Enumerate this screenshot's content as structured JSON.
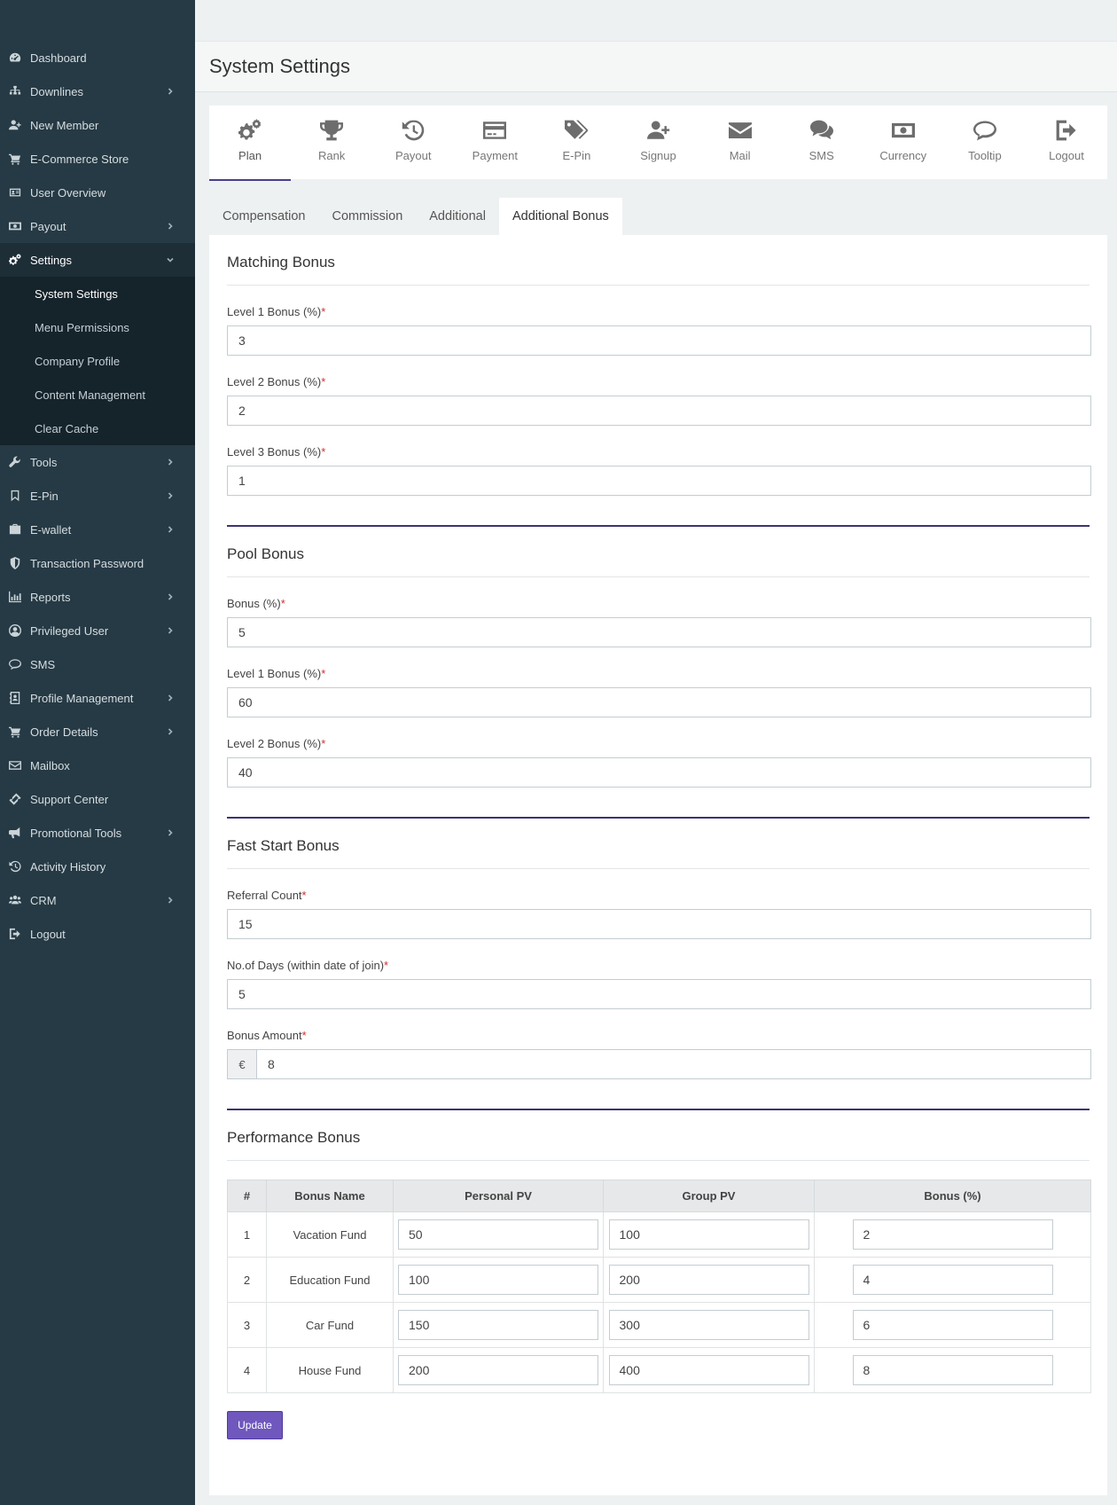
{
  "sidebar": {
    "items": [
      {
        "label": "Dashboard",
        "icon": "dashboard-icon",
        "chevron": false
      },
      {
        "label": "Downlines",
        "icon": "sitemap-icon",
        "chevron": true
      },
      {
        "label": "New Member",
        "icon": "user-plus-icon",
        "chevron": false
      },
      {
        "label": "E-Commerce Store",
        "icon": "cart-icon",
        "chevron": false
      },
      {
        "label": "User Overview",
        "icon": "id-card-icon",
        "chevron": false
      },
      {
        "label": "Payout",
        "icon": "money-icon",
        "chevron": true
      },
      {
        "label": "Settings",
        "icon": "cogs-icon",
        "chevron": true,
        "expanded": true
      }
    ],
    "settings_sub": [
      {
        "label": "System Settings"
      },
      {
        "label": "Menu Permissions"
      },
      {
        "label": "Company Profile"
      },
      {
        "label": "Content Management"
      },
      {
        "label": "Clear Cache"
      }
    ],
    "items_after": [
      {
        "label": "Tools",
        "icon": "wrench-icon",
        "chevron": true
      },
      {
        "label": "E-Pin",
        "icon": "bookmark-icon",
        "chevron": true
      },
      {
        "label": "E-wallet",
        "icon": "briefcase-icon",
        "chevron": true
      },
      {
        "label": "Transaction Password",
        "icon": "shield-icon",
        "chevron": false
      },
      {
        "label": "Reports",
        "icon": "bar-chart-icon",
        "chevron": true
      },
      {
        "label": "Privileged User",
        "icon": "user-circle-icon",
        "chevron": true
      },
      {
        "label": "SMS",
        "icon": "comment-icon",
        "chevron": false
      },
      {
        "label": "Profile Management",
        "icon": "address-book-icon",
        "chevron": true
      },
      {
        "label": "Order Details",
        "icon": "cart-icon",
        "chevron": true
      },
      {
        "label": "Mailbox",
        "icon": "envelope-icon",
        "chevron": false
      },
      {
        "label": "Support Center",
        "icon": "ticket-icon",
        "chevron": false
      },
      {
        "label": "Promotional Tools",
        "icon": "bullhorn-icon",
        "chevron": true
      },
      {
        "label": "Activity History",
        "icon": "history-icon",
        "chevron": false
      },
      {
        "label": "CRM",
        "icon": "users-icon",
        "chevron": true
      },
      {
        "label": "Logout",
        "icon": "sign-out-icon",
        "chevron": false
      }
    ]
  },
  "header": {
    "title": "System Settings"
  },
  "icon_tabs": [
    {
      "label": "Plan",
      "icon": "cogs-icon",
      "active": true
    },
    {
      "label": "Rank",
      "icon": "trophy-icon"
    },
    {
      "label": "Payout",
      "icon": "history-icon"
    },
    {
      "label": "Payment",
      "icon": "credit-card-icon"
    },
    {
      "label": "E-Pin",
      "icon": "tags-icon"
    },
    {
      "label": "Signup",
      "icon": "user-plus-icon"
    },
    {
      "label": "Mail",
      "icon": "envelope-icon"
    },
    {
      "label": "SMS",
      "icon": "comments-icon"
    },
    {
      "label": "Currency",
      "icon": "money-icon"
    },
    {
      "label": "Tooltip",
      "icon": "comment-icon"
    },
    {
      "label": "Logout",
      "icon": "sign-out-icon"
    }
  ],
  "sub_tabs": [
    {
      "label": "Compensation"
    },
    {
      "label": "Commission"
    },
    {
      "label": "Additional"
    },
    {
      "label": "Additional Bonus",
      "active": true
    }
  ],
  "matching": {
    "title": "Matching Bonus",
    "fields": [
      {
        "label": "Level 1 Bonus (%)",
        "value": "3"
      },
      {
        "label": "Level 2 Bonus (%)",
        "value": "2"
      },
      {
        "label": "Level 3 Bonus (%)",
        "value": "1"
      }
    ]
  },
  "pool": {
    "title": "Pool Bonus",
    "fields": [
      {
        "label": "Bonus (%)",
        "value": "5"
      },
      {
        "label": "Level 1 Bonus (%)",
        "value": "60"
      },
      {
        "label": "Level 2 Bonus (%)",
        "value": "40"
      }
    ]
  },
  "fast": {
    "title": "Fast Start Bonus",
    "fields": [
      {
        "label": "Referral Count",
        "value": "15"
      },
      {
        "label": "No.of Days (within date of join)",
        "value": "5"
      }
    ],
    "amount": {
      "label": "Bonus Amount",
      "currency": "€",
      "value": "8"
    }
  },
  "required_mark": "*",
  "performance": {
    "title": "Performance Bonus",
    "columns": [
      "#",
      "Bonus Name",
      "Personal PV",
      "Group PV",
      "Bonus (%)"
    ],
    "rows": [
      {
        "num": "1",
        "name": "Vacation Fund",
        "personal": "50",
        "group": "100",
        "bonus": "2"
      },
      {
        "num": "2",
        "name": "Education Fund",
        "personal": "100",
        "group": "200",
        "bonus": "4"
      },
      {
        "num": "3",
        "name": "Car Fund",
        "personal": "150",
        "group": "300",
        "bonus": "6"
      },
      {
        "num": "4",
        "name": "House Fund",
        "personal": "200",
        "group": "400",
        "bonus": "8"
      }
    ],
    "update_label": "Update"
  },
  "colors": {
    "sidebar_bg": "#263a45",
    "accent": "#3b3472",
    "button": "#6f57bd",
    "required": "#d02d2d"
  }
}
